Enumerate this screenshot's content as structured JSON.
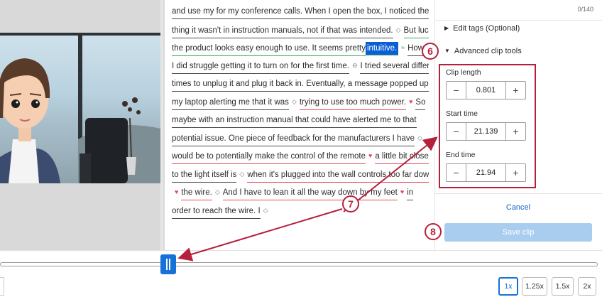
{
  "transcript": {
    "lines": [
      [
        {
          "t": "and use my for my conference calls. When I open the box, I noticed the first",
          "u": "gray"
        }
      ],
      [
        {
          "t": "thing it wasn't in instruction manuals, not if that was intended.",
          "u": "gray"
        },
        {
          "icon": "◇",
          "c": "gray"
        },
        {
          "t": "But luckily",
          "u": "green"
        }
      ],
      [
        {
          "t": "the product looks easy enough to use. It seems pretty ",
          "u": "green"
        },
        {
          "t": "intuitive.",
          "u": "green",
          "hl": true
        },
        {
          "icon": "≈",
          "c": "green"
        },
        {
          "t": "However,",
          "u": "gray"
        }
      ],
      [
        {
          "t": "I did struggle getting it to turn on for the first time.",
          "u": "gray"
        },
        {
          "icon": "⊖",
          "c": "gray"
        },
        {
          "t": "I tried several different",
          "u": "gray"
        }
      ],
      [
        {
          "t": "times to unplug it and plug it back in. Eventually, a message popped up on",
          "u": "gray"
        }
      ],
      [
        {
          "t": "my laptop alerting me that it was",
          "u": "gray"
        },
        {
          "icon": "◇",
          "c": "gray"
        },
        {
          "t": "trying to use too much power.",
          "u": "red"
        },
        {
          "icon": "♥",
          "c": "red"
        },
        {
          "t": "So",
          "u": "gray"
        }
      ],
      [
        {
          "t": "maybe with an instruction manual that could have alerted me to that",
          "u": "gray"
        }
      ],
      [
        {
          "t": "potential issue. One piece of feedback for the manufacturers I have",
          "u": "gray"
        },
        {
          "icon": "◇",
          "c": "gray"
        }
      ],
      [
        {
          "t": "would be to potentially make the control of the remote",
          "u": "red"
        },
        {
          "icon": "♥",
          "c": "red"
        },
        {
          "t": "a little bit closer",
          "u": "red"
        }
      ],
      [
        {
          "t": "to the light itself is",
          "u": "gray"
        },
        {
          "icon": "◇",
          "c": "gray"
        },
        {
          "t": "when it's plugged into the wall controls too far down",
          "u": "red"
        }
      ],
      [
        {
          "icon": "♥",
          "c": "red"
        },
        {
          "t": "the wire.",
          "u": "red"
        },
        {
          "icon": "◇",
          "c": "gray"
        },
        {
          "t": "And I have to lean it all the way down by my feet",
          "u": "red"
        },
        {
          "icon": "♥",
          "c": "red"
        },
        {
          "t": "in",
          "u": "gray"
        }
      ],
      [
        {
          "t": "order to reach the wire. I",
          "u": "gray"
        },
        {
          "icon": "◇",
          "c": "gray"
        }
      ]
    ]
  },
  "panel": {
    "counter": "0/140",
    "edit_tags": "Edit tags (Optional)",
    "advanced": "Advanced clip tools",
    "clip_length_label": "Clip length",
    "clip_length": "0.801",
    "start_label": "Start time",
    "start": "21.139",
    "end_label": "End time",
    "end": "21.94",
    "minus": "−",
    "plus": "+",
    "cancel": "Cancel",
    "save": "Save clip"
  },
  "badges": {
    "six": "6",
    "seven": "7",
    "eight": "8"
  },
  "speeds": [
    "1x",
    "1.25x",
    "1.5x",
    "2x"
  ],
  "colors": {
    "accent": "#1672d6",
    "annotation": "#b5203a",
    "save_disabled": "#a9cdef"
  }
}
